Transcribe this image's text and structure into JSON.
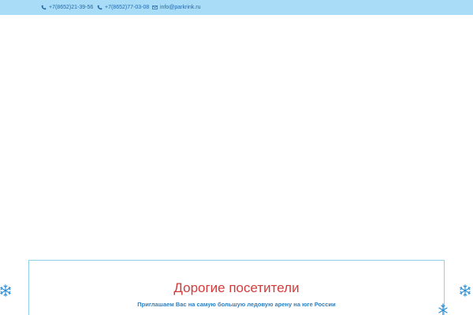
{
  "topbar": {
    "phone1": "+7(8652)21-39-56",
    "phone2": "+7(8652)77-03-08",
    "email": "info@parkrink.ru",
    "phone_icon": "phone-icon",
    "email_icon": "envelope-icon",
    "background_color": "#a8dcf7",
    "link_color": "#2468b0"
  },
  "notice": {
    "title": "Дорогие посетители",
    "subtitle": "Приглашаем Вас на самую большую ледовую арену на юге России",
    "title_color": "#d43a3a",
    "subtitle_color": "#2d7fc1",
    "border_color": "#8fd3e8"
  },
  "decorations": {
    "left_icon": "snowflake-icon",
    "right_icon": "snowflake-icon",
    "color": "#2a8fd6"
  }
}
